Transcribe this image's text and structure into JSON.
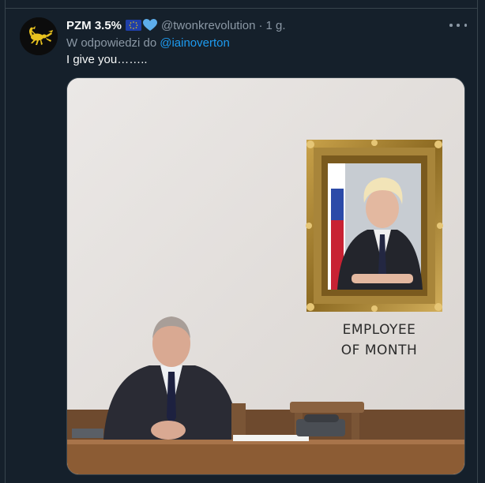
{
  "tweet": {
    "display_name": "PZM 3.5%",
    "handle": "@twonkrevolution",
    "separator": "·",
    "time": "1 g.",
    "reply_prefix": "W odpowiedzi do",
    "reply_to": "@iainoverton",
    "text": "I give you……..",
    "badges": [
      "eu-flag-icon",
      "blue-heart-icon"
    ],
    "media": {
      "caption_line1": "EMPLOYEE",
      "caption_line2": "OF MONTH"
    }
  },
  "colors": {
    "background": "#15202b",
    "border": "#38444d",
    "secondary_text": "#8b98a5",
    "link": "#1d9bf0"
  }
}
